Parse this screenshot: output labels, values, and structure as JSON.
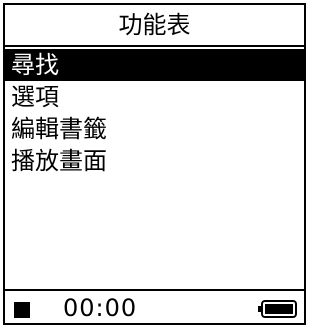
{
  "header": {
    "title": "功能表"
  },
  "menu": {
    "items": [
      {
        "label": "尋找",
        "selected": true
      },
      {
        "label": "選項",
        "selected": false
      },
      {
        "label": "編輯書籤",
        "selected": false
      },
      {
        "label": "播放畫面",
        "selected": false
      }
    ]
  },
  "status": {
    "playback_icon": "stop-icon",
    "time": "00:00",
    "battery_icon": "battery-full-icon",
    "battery_level": 1.0
  }
}
